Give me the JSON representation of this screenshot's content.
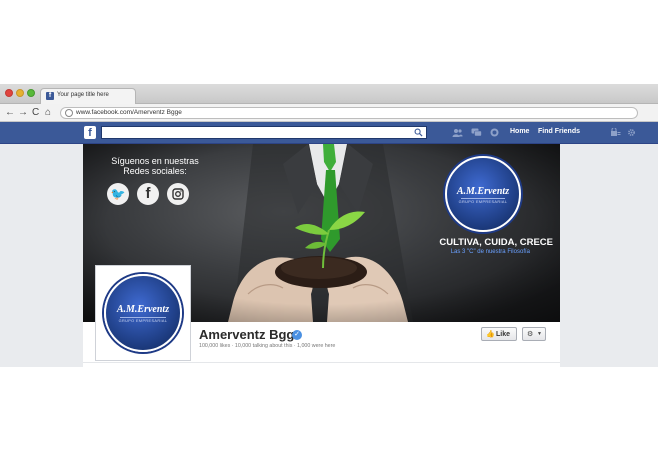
{
  "browser": {
    "tab_title": "Your page title here",
    "url": "www.facebook.com/Amerventz Bgge",
    "nav": {
      "back": "←",
      "forward": "→",
      "reload": "C",
      "home": "⌂"
    }
  },
  "fb_bar": {
    "logo": "f",
    "search_placeholder": "",
    "links": {
      "home": "Home",
      "find_friends": "Find Friends"
    }
  },
  "cover": {
    "follow_text": "Síguenos en nuestras Redes sociales:",
    "social_icons": [
      "twitter-icon",
      "facebook-icon",
      "instagram-icon"
    ],
    "brand_name": "A.M.Erventz",
    "brand_tagline": "GRUPO EMPRESARIAL",
    "motto": "CULTIVA, CUIDA, CRECE",
    "motto_sub": "Las 3 \"C\" de nuestra Filosofía"
  },
  "profile": {
    "brand_name": "A.M.Erventz",
    "brand_tagline": "GRUPO EMPRESARIAL"
  },
  "page": {
    "name": "Amerventz Bgge",
    "verified": "✓",
    "stats": "100,000 likes · 10,000 talking about this · 1,000 were here",
    "like_label": "Like",
    "like_icon": "👍",
    "settings_icon": "⚙",
    "settings_caret": "▼"
  },
  "colors": {
    "facebook_blue": "#3b5998",
    "brand_blue": "#23448f",
    "accent_link": "#6aa0ff"
  }
}
